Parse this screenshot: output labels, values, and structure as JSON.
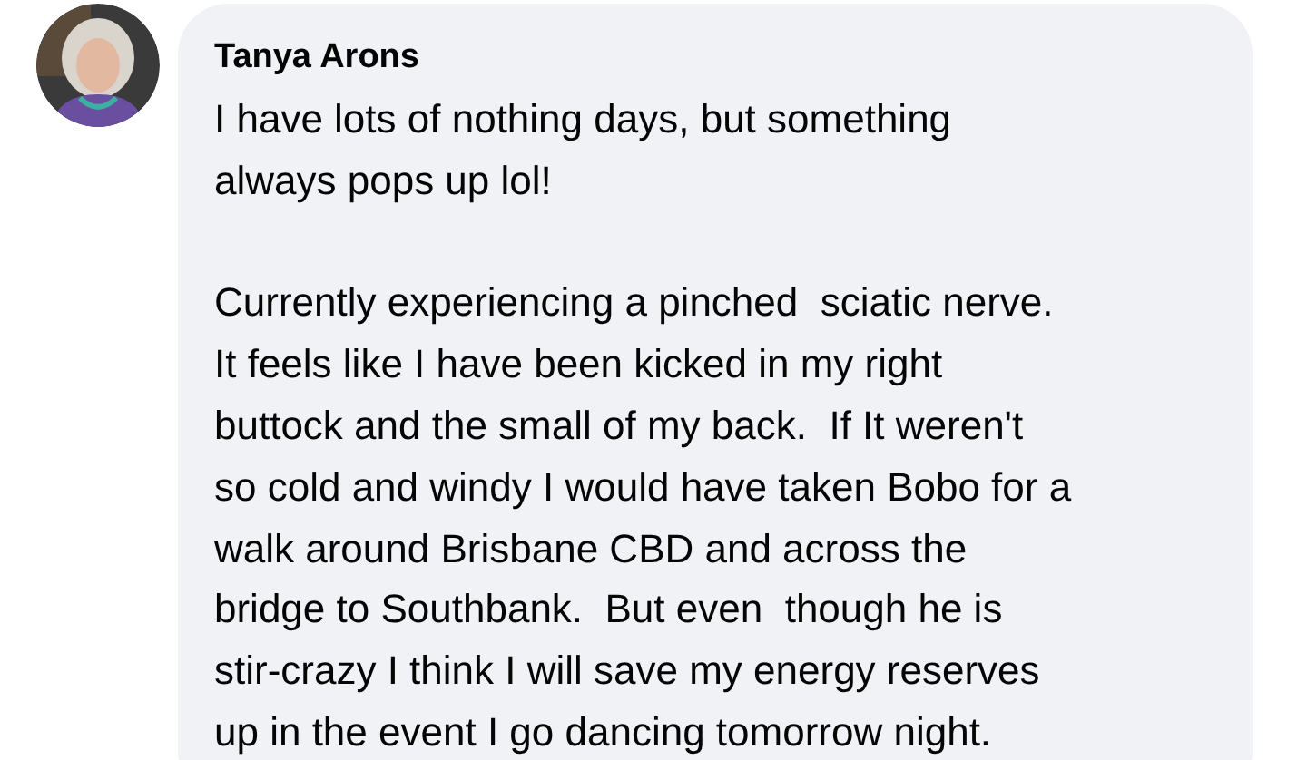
{
  "comment": {
    "author": "Tanya Arons",
    "text": "I have lots of nothing days, but something\nalways pops up lol!\n\nCurrently experiencing a pinched  sciatic nerve.\nIt feels like I have been kicked in my right\nbuttock and the small of my back.  If It weren't\nso cold and windy I would have taken Bobo for a\nwalk around Brisbane CBD and across the\nbridge to Southbank.  But even  though he is\nstir-crazy I think I will save my energy reserves\nup in the event I go dancing tomorrow night."
  }
}
